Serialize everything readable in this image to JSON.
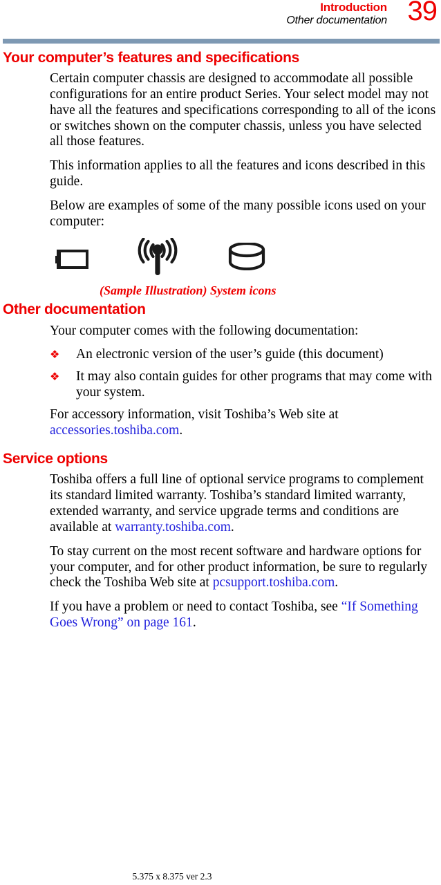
{
  "header": {
    "chapter": "Introduction",
    "section": "Other documentation",
    "page_number": "39",
    "rule_color": "#7e99b3"
  },
  "colors": {
    "heading_red": "#ee0000",
    "link_blue": "#2222dd",
    "text_black": "#000000"
  },
  "sections": [
    {
      "title": "Your computer’s features and specifications",
      "paragraphs": [
        "Certain computer chassis are designed to accommodate all possible configurations for an entire product Series. Your select model may not have all the features and specifications corresponding to all of the icons or switches shown on the computer chassis, unless you have selected all those features.",
        "This information applies to all the features and icons described in this guide.",
        "Below are examples of some of the many possible icons used on your computer:"
      ]
    },
    {
      "title": "Other documentation",
      "intro": "Your computer comes with the following documentation:",
      "bullets": [
        "An electronic version of the user’s guide (this document)",
        "It may also contain guides for other programs that may come with your system."
      ],
      "closing_prefix": "For accessory information, visit Toshiba’s Web site at ",
      "closing_link": "accessories.toshiba.com",
      "closing_suffix": "."
    },
    {
      "title": "Service options",
      "p1_prefix": "Toshiba offers a full line of optional service programs to complement its standard limited warranty. Toshiba’s standard limited warranty, extended warranty, and service upgrade terms and conditions are available at ",
      "p1_link": "warranty.toshiba.com",
      "p1_suffix": ".",
      "p2_prefix": "To stay current on the most recent software and hardware options for your computer, and for other product information, be sure to regularly check the Toshiba Web site at ",
      "p2_link": "pcsupport.toshiba.com",
      "p2_suffix": ".",
      "p3_prefix": "If you have a problem or need to contact Toshiba, see ",
      "p3_link": "“If Something Goes Wrong” on page 161",
      "p3_suffix": "."
    }
  ],
  "figure": {
    "caption": "(Sample Illustration) System icons",
    "icons": [
      {
        "name": "battery-icon",
        "label": "battery"
      },
      {
        "name": "wireless-antenna-icon",
        "label": "wireless antenna"
      },
      {
        "name": "disk-drive-icon",
        "label": "disk drive"
      }
    ]
  },
  "bullet_glyph": "❖",
  "footer": {
    "text": "5.375 x 8.375 ver 2.3"
  }
}
